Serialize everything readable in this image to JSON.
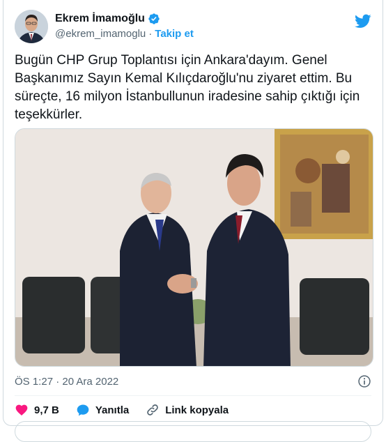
{
  "author": {
    "display_name": "Ekrem İmamoğlu",
    "handle": "@ekrem_imamoglu",
    "separator": "·",
    "follow_label": "Takip et"
  },
  "tweet": {
    "text": "Bugün CHP Grup Toplantısı için Ankara'dayım. Genel Başkanımız Sayın Kemal Kılıçdaroğlu'nu ziyaret ettim. Bu süreçte, 16 milyon İstanbullunun iradesine sahip çıktığı için teşekkürler.",
    "timestamp": "ÖS 1:27 · 20 Ara 2022"
  },
  "actions": {
    "likes": "9,7 B",
    "reply_label": "Yanıtla",
    "copy_link_label": "Link kopyala"
  },
  "colors": {
    "accent": "#1d9bf0",
    "like": "#f91880",
    "text": "#0f1419",
    "muted": "#536471"
  },
  "icons": [
    "verified-badge-icon",
    "twitter-bird-icon",
    "info-icon",
    "heart-icon",
    "reply-bubble-icon",
    "link-icon"
  ]
}
